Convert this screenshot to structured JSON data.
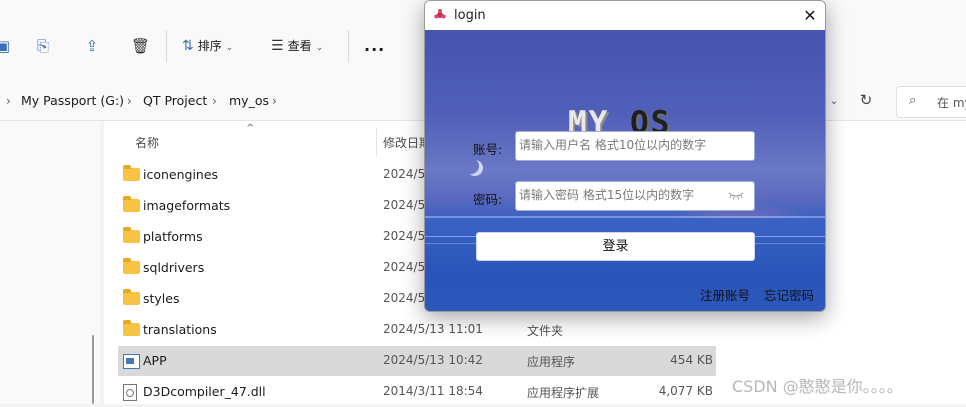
{
  "explorer": {
    "toolbar": {
      "sort_label": "排序",
      "view_label": "查看",
      "more_label": "..."
    },
    "breadcrumb": [
      "My Passport (G:)",
      "QT Project",
      "my_os"
    ],
    "search_placeholder": "在 my",
    "columns": {
      "name": "名称",
      "date": "修改日期"
    },
    "files": [
      {
        "name": "iconengines",
        "date": "2024/5",
        "type": "",
        "size": "",
        "kind": "folder"
      },
      {
        "name": "imageformats",
        "date": "2024/5",
        "type": "",
        "size": "",
        "kind": "folder"
      },
      {
        "name": "platforms",
        "date": "2024/5",
        "type": "",
        "size": "",
        "kind": "folder"
      },
      {
        "name": "sqldrivers",
        "date": "2024/5",
        "type": "",
        "size": "",
        "kind": "folder"
      },
      {
        "name": "styles",
        "date": "2024/5",
        "type": "",
        "size": "",
        "kind": "folder"
      },
      {
        "name": "translations",
        "date": "2024/5/13 11:01",
        "type": "文件夹",
        "size": "",
        "kind": "folder"
      },
      {
        "name": "APP",
        "date": "2024/5/13 10:42",
        "type": "应用程序",
        "size": "454 KB",
        "kind": "app"
      },
      {
        "name": "D3Dcompiler_47.dll",
        "date": "2014/3/11 18:54",
        "type": "应用程序扩展",
        "size": "4,077 KB",
        "kind": "dll"
      }
    ],
    "selected_index": 6
  },
  "login": {
    "title": "login",
    "logo_part1": "MY",
    "logo_part2": "OS",
    "account_label": "账号:",
    "account_placeholder": "请输入用户名 格式10位以内的数字",
    "password_label": "密码:",
    "password_placeholder": "请输入密码 格式15位以内的数字",
    "login_button": "登录",
    "register_link": "注册账号",
    "forgot_link": "忘记密码"
  },
  "watermark": "CSDN @憨憨是你。。。。",
  "colors": {
    "accent": "#3a6fb8",
    "dialog_bg": "#4654b0",
    "folder": "#f6c343",
    "selected_row": "#d9d9d9"
  },
  "icons": [
    "copy-icon",
    "share-icon",
    "delete-icon",
    "sort-icon",
    "view-icon",
    "more-icon",
    "refresh-icon",
    "search-icon",
    "folder-icon",
    "app-file-icon",
    "dll-file-icon",
    "close-icon",
    "eye-icon"
  ]
}
